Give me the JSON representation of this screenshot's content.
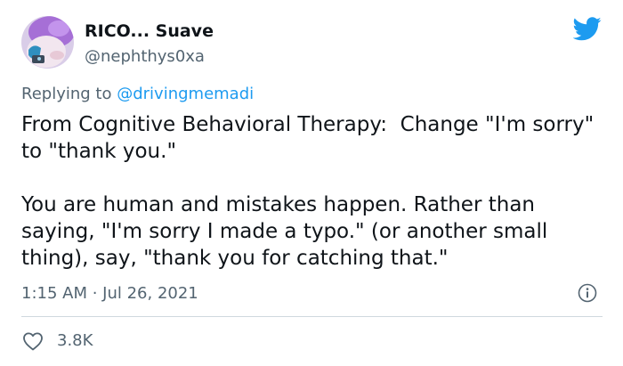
{
  "tweet": {
    "author_name": "RICO... Suave",
    "author_handle": "@nephthys0xa",
    "replying_prefix": "Replying to",
    "replying_handle": "@drivingmemadi",
    "paragraph_1": "From Cognitive Behavioral Therapy:  Change \"I'm sorry\" to \"thank you.\"",
    "paragraph_2": "You are human and mistakes happen. Rather than saying, \"I'm sorry I made a typo.\" (or another small thing), say, \"thank you for catching that.\"",
    "timestamp": "1:15 AM · Jul 26, 2021",
    "likes": "3.8K"
  },
  "icons": {
    "brand": "twitter-bird-icon",
    "info": "info-icon",
    "like": "heart-icon"
  },
  "colors": {
    "brand_blue": "#1d9bf0",
    "text_primary": "#0f1419",
    "text_secondary": "#536471",
    "divider": "#cfd9de"
  }
}
